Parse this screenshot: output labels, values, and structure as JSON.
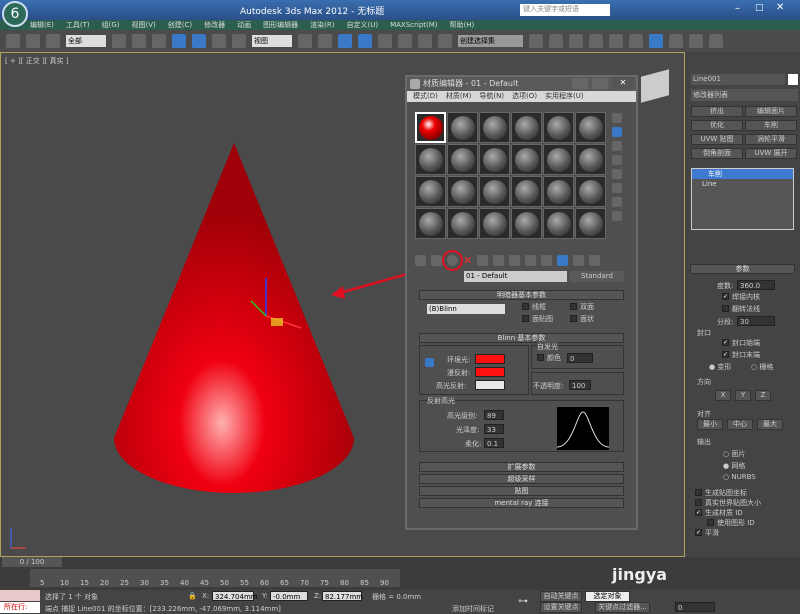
{
  "titlebar": {
    "title": "Autodesk 3ds Max 2012  -  无标题",
    "search_placeholder": "键入关键字或短语"
  },
  "menu": [
    "编辑(E)",
    "工具(T)",
    "组(G)",
    "视图(V)",
    "创建(C)",
    "修改器",
    "动画",
    "图形编辑器",
    "渲染(R)",
    "自定义(U)",
    "MAXScript(M)",
    "帮助(H)"
  ],
  "toolbar": {
    "selection_filter": "全部",
    "ref_coord": "视图",
    "named_selection": "创建选择集"
  },
  "viewport": {
    "label": "[ + ][ 正交 ][ 真实 ]",
    "object_color": "#e8000a"
  },
  "material_editor": {
    "title": "材质编辑器 - 01 - Default",
    "menu": [
      "模式(D)",
      "材质(M)",
      "导航(N)",
      "选项(O)",
      "实用程序(U)"
    ],
    "material_name": "01 - Default",
    "material_type": "Standard",
    "shader_rollout": "明暗器基本参数",
    "shader": "(B)Blinn",
    "shader_options": [
      {
        "label": "线框",
        "checked": false
      },
      {
        "label": "双面",
        "checked": false
      },
      {
        "label": "面贴图",
        "checked": false
      },
      {
        "label": "面状",
        "checked": false
      }
    ],
    "blinn_rollout": "Blinn 基本参数",
    "ambient_label": "环境光:",
    "diffuse_label": "漫反射:",
    "specular_label": "高光反射:",
    "ambient_color": "#ff1010",
    "diffuse_color": "#ff1010",
    "specular_color": "#e6e6e6",
    "self_illum_group": "自发光",
    "self_illum_color_label": "颜色",
    "self_illum_value": "0",
    "opacity_label": "不透明度:",
    "opacity_value": "100",
    "spec_group": "反射高光",
    "spec_level_label": "高光级别:",
    "spec_level": "89",
    "gloss_label": "光泽度:",
    "gloss": "33",
    "soften_label": "柔化:",
    "soften": "0.1",
    "rollouts": [
      "扩展参数",
      "超级采样",
      "贴图",
      "mental ray 连接"
    ]
  },
  "command_panel": {
    "object_name": "Line001",
    "modifier_list": "修改器列表",
    "buttons": [
      "挤出",
      "编辑面片",
      "优化",
      "车削",
      "UVW 贴图",
      "涡轮平滑",
      "倒角剖面",
      "UVW 展开"
    ],
    "stack": [
      "车削",
      "Line"
    ],
    "params_rollout": "参数",
    "degrees_label": "度数:",
    "degrees": "360.0",
    "weld_core": "焊接内核",
    "weld_core_checked": true,
    "flip_normals": "翻转法线",
    "flip_normals_checked": false,
    "segments_label": "分段:",
    "segments": "30",
    "capping": "封口",
    "cap_start": "封口始端",
    "cap_end": "封口末端",
    "morph": "变形",
    "grid": "栅格",
    "direction": "方向",
    "dir_buttons": [
      "X",
      "Y",
      "Z"
    ],
    "align": "对齐",
    "align_buttons": [
      "最小",
      "中心",
      "最大"
    ],
    "output": "输出",
    "output_options": [
      "面片",
      "网格",
      "NURBS"
    ],
    "output_selected": "网格",
    "checks": [
      {
        "label": "生成贴图坐标",
        "checked": false
      },
      {
        "label": "真实世界贴图大小",
        "checked": false
      },
      {
        "label": "生成材质 ID",
        "checked": true
      },
      {
        "label": "使用图形 ID",
        "checked": false
      },
      {
        "label": "平滑",
        "checked": true
      }
    ]
  },
  "timeline": {
    "frame": "0 / 100",
    "ticks": [
      "5",
      "10",
      "15",
      "20",
      "25",
      "30",
      "35",
      "40",
      "45",
      "50",
      "55",
      "60",
      "65",
      "70",
      "75",
      "80",
      "85",
      "90"
    ]
  },
  "status": {
    "mode": "所在行:",
    "selected": "选择了 1 个 对象",
    "prompt": "端点 捕捉 Line001 的坐标位置：[233.226mm, -47.069mm, 3.114mm]",
    "x": "324.704mm",
    "y": "-0.0mm",
    "z": "82.177mm",
    "grid": "栅格 = 0.0mm",
    "add_tag": "添加时间标记",
    "auto_key": "自动关键点",
    "set_key": "设置关键点",
    "key_filter": "选定对象",
    "key_filters_btn": "关键点过滤器...",
    "frame_value": "0"
  },
  "watermark": "jingya"
}
